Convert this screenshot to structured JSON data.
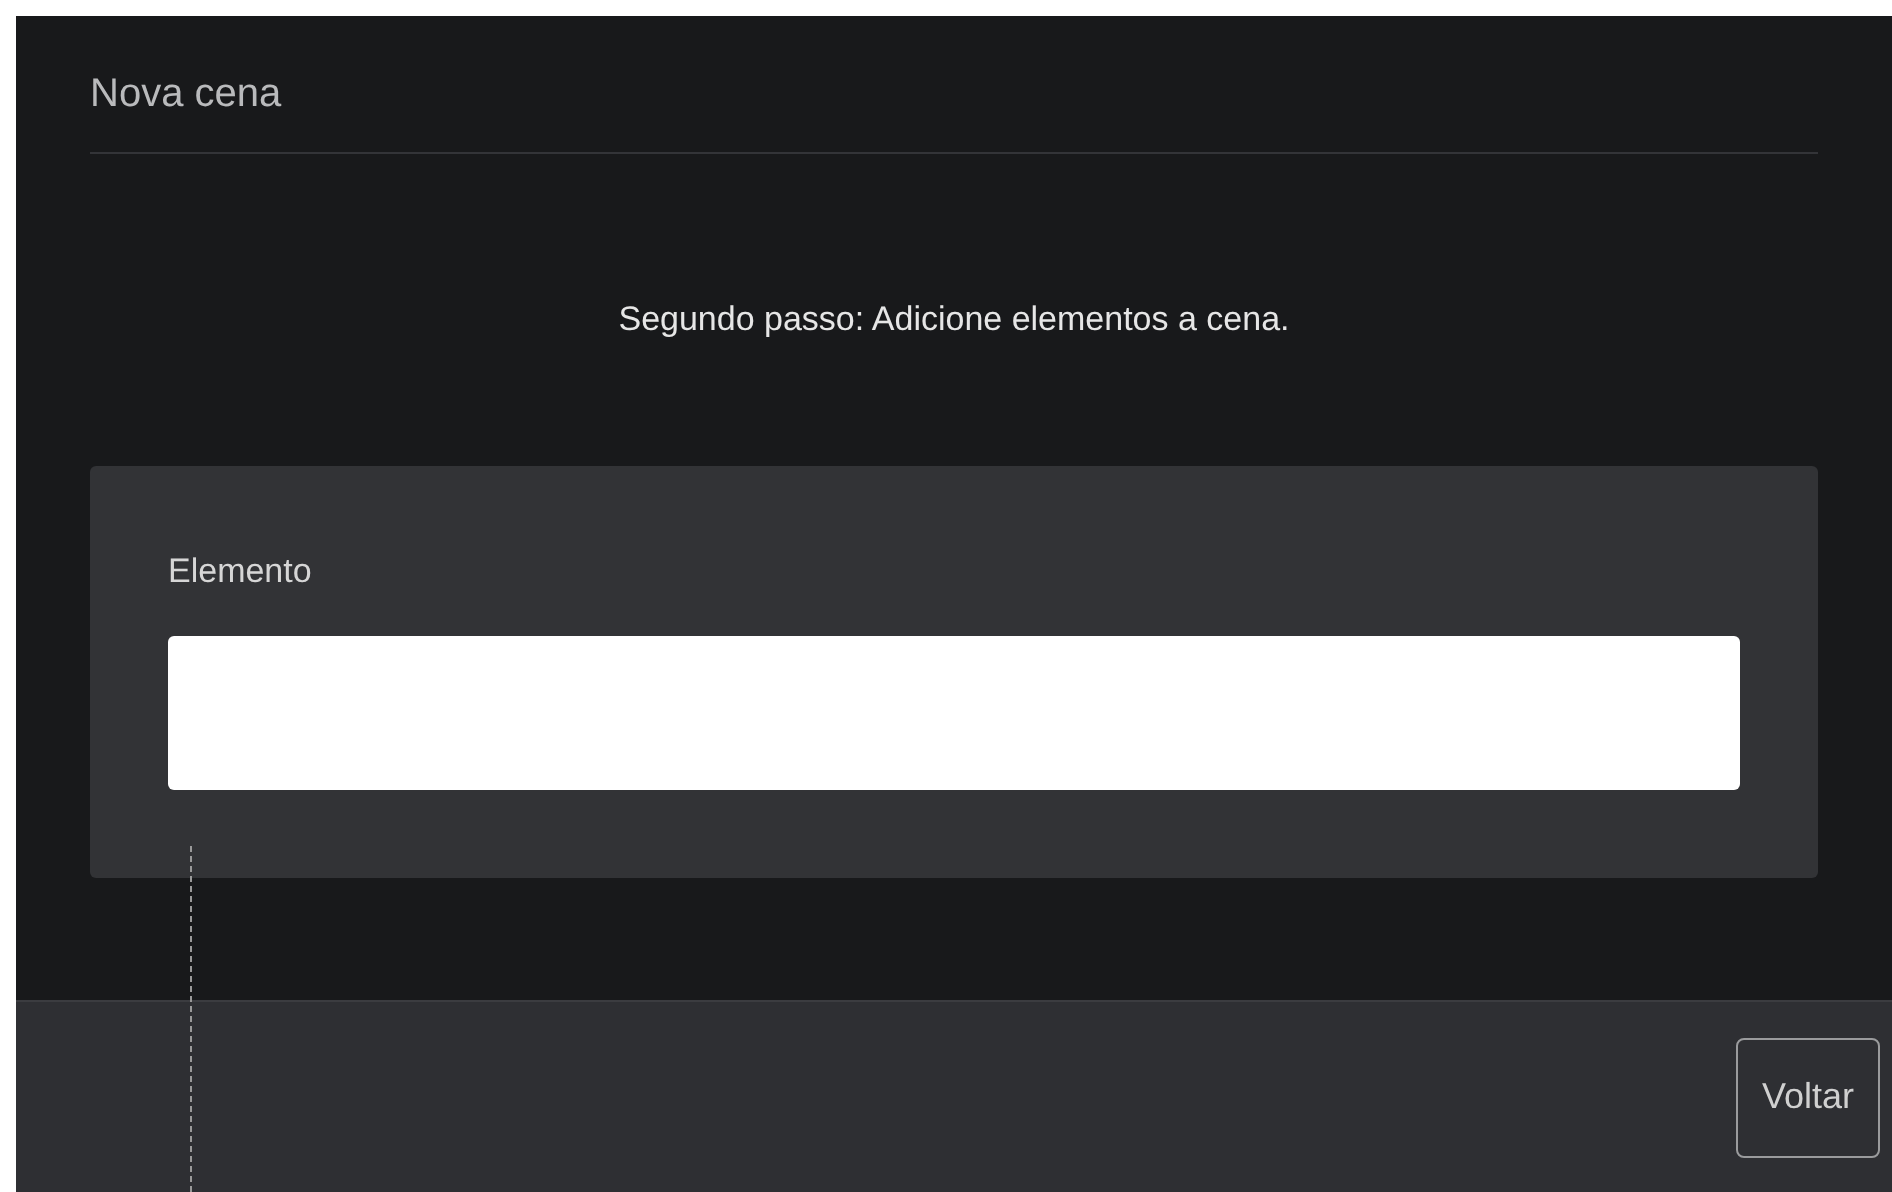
{
  "dialog": {
    "title": "Nova cena",
    "instruction": "Segundo passo: Adicione elementos a cena.",
    "field": {
      "label": "Elemento"
    },
    "buttons": [
      "Voltar"
    ]
  }
}
